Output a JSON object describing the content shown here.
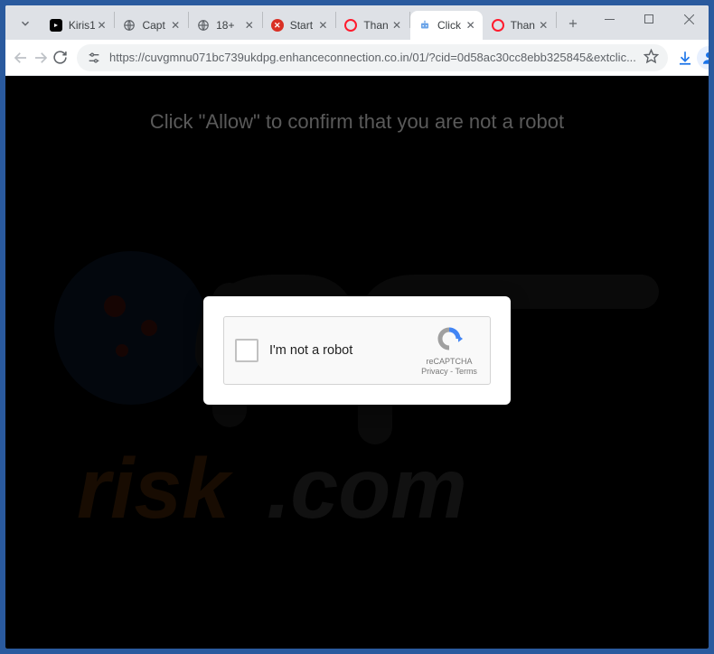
{
  "tabs": [
    {
      "title": "Kiris1",
      "favicon": "youtube"
    },
    {
      "title": "Capt",
      "favicon": "globe"
    },
    {
      "title": "18+",
      "favicon": "globe"
    },
    {
      "title": "Start",
      "favicon": "red-x"
    },
    {
      "title": "Than",
      "favicon": "opera"
    },
    {
      "title": "Click",
      "favicon": "bot",
      "active": true
    },
    {
      "title": "Than",
      "favicon": "opera"
    }
  ],
  "omnibox": {
    "url": "https://cuvgmnu071bc739ukdpg.enhanceconnection.co.in/01/?cid=0d58ac30cc8ebb325845&extclic..."
  },
  "page": {
    "heading": "Click \"Allow\" to confirm that you are not a robot"
  },
  "recaptcha": {
    "label": "I'm not a robot",
    "brand": "reCAPTCHA",
    "privacy": "Privacy",
    "terms": "Terms"
  },
  "watermark": "pcrisk.com"
}
